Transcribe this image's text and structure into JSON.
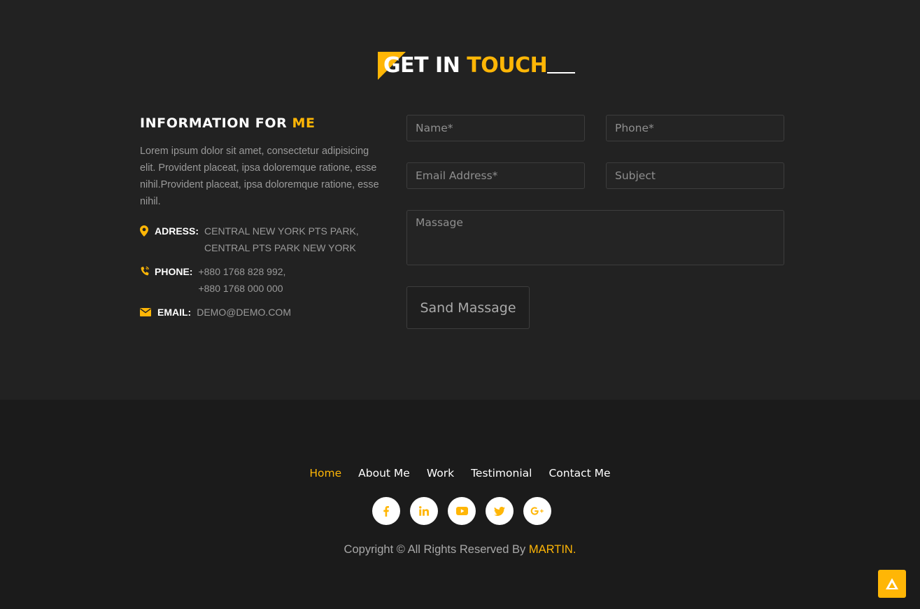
{
  "section_title": {
    "white": "GET IN ",
    "accent": "TOUCH"
  },
  "info": {
    "heading_white": "INFORMATION FOR ",
    "heading_accent": "ME",
    "description": "Lorem ipsum dolor sit amet, consectetur adipisicing elit. Provident placeat, ipsa doloremque ratione, esse nihil.Provident placeat, ipsa doloremque ratione, esse nihil.",
    "address_label": "ADRESS:",
    "address_line1": "CENTRAL NEW YORK PTS PARK,",
    "address_line2": "CENTRAL PTS PARK NEW YORK",
    "phone_label": "PHONE:",
    "phone_line1": "+880 1768 828 992,",
    "phone_line2": "+880 1768 000 000",
    "email_label": "EMAIL:",
    "email_value": "DEMO@DEMO.COM"
  },
  "form": {
    "name_placeholder": "Name*",
    "phone_placeholder": "Phone*",
    "email_placeholder": "Email Address*",
    "subject_placeholder": "Subject",
    "message_placeholder": "Massage",
    "send_label": "Sand Massage"
  },
  "footer": {
    "nav": [
      "Home",
      "About Me",
      "Work",
      "Testimonial",
      "Contact Me"
    ],
    "active_nav": "Home",
    "socials": [
      "facebook-icon",
      "linkedin-icon",
      "youtube-icon",
      "twitter-icon",
      "google-plus-icon"
    ],
    "copyright_text": "Copyright © All Rights Reserved By ",
    "copyright_brand": "MARTIN."
  },
  "colors": {
    "accent": "#ffb606",
    "section_bg": "#222222",
    "footer_bg": "#1b1b1b"
  }
}
